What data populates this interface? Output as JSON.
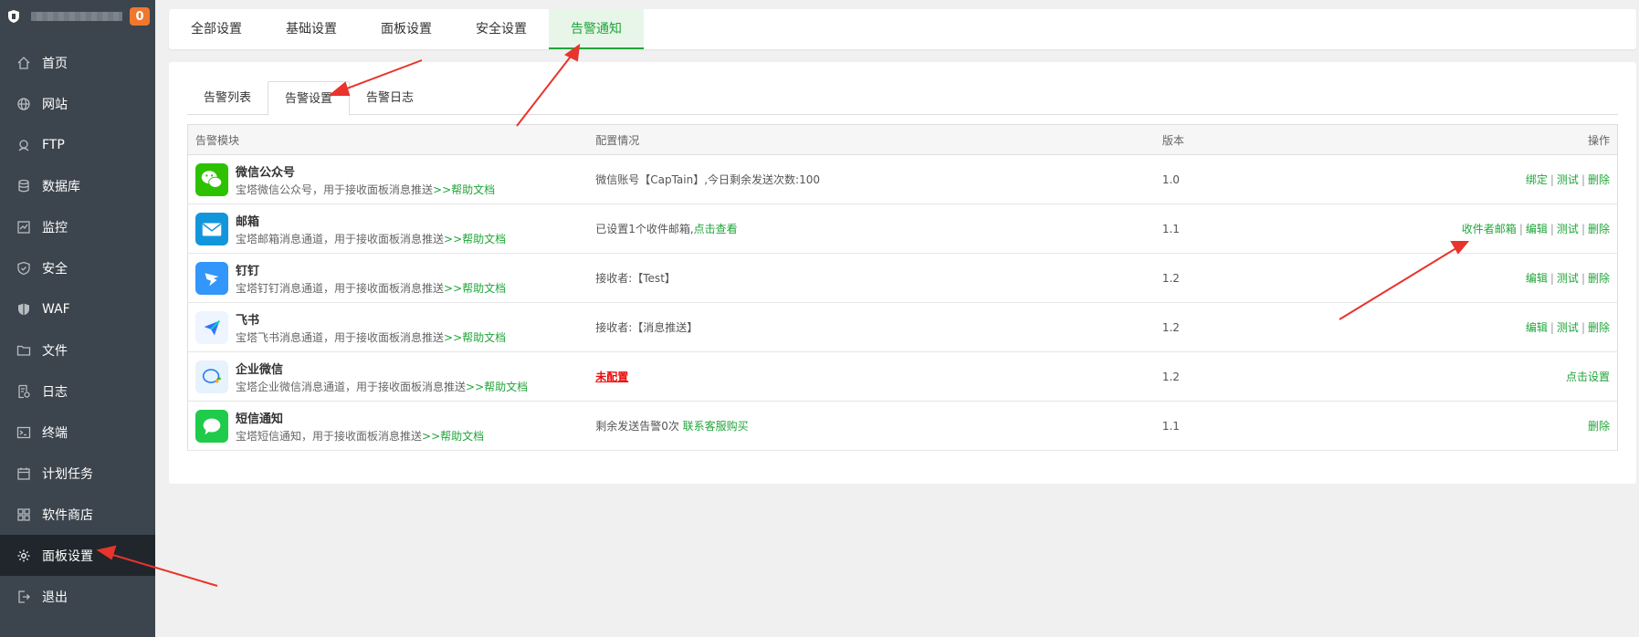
{
  "sidebar": {
    "badge": "0",
    "items": [
      {
        "label": "首页",
        "icon": "home-icon"
      },
      {
        "label": "网站",
        "icon": "globe-icon"
      },
      {
        "label": "FTP",
        "icon": "ftp-icon"
      },
      {
        "label": "数据库",
        "icon": "database-icon"
      },
      {
        "label": "监控",
        "icon": "monitor-icon"
      },
      {
        "label": "安全",
        "icon": "shield-icon"
      },
      {
        "label": "WAF",
        "icon": "waf-shield-icon"
      },
      {
        "label": "文件",
        "icon": "folder-icon"
      },
      {
        "label": "日志",
        "icon": "log-icon"
      },
      {
        "label": "终端",
        "icon": "terminal-icon"
      },
      {
        "label": "计划任务",
        "icon": "calendar-icon"
      },
      {
        "label": "软件商店",
        "icon": "grid-icon"
      },
      {
        "label": "面板设置",
        "icon": "gear-icon"
      },
      {
        "label": "退出",
        "icon": "logout-icon"
      }
    ]
  },
  "top_tabs": [
    "全部设置",
    "基础设置",
    "面板设置",
    "安全设置",
    "告警通知"
  ],
  "sub_tabs": [
    "告警列表",
    "告警设置",
    "告警日志"
  ],
  "table": {
    "headers": {
      "module": "告警模块",
      "config": "配置情况",
      "version": "版本",
      "action": "操作"
    },
    "rows": [
      {
        "name": "微信公众号",
        "desc": "宝塔微信公众号，用于接收面板消息推送",
        "help": ">>帮助文档",
        "config": "微信账号【CapTain】,今日剩余发送次数:100",
        "config_link": "",
        "version": "1.0",
        "actions": [
          "绑定",
          "测试",
          "删除"
        ]
      },
      {
        "name": "邮箱",
        "desc": "宝塔邮箱消息通道，用于接收面板消息推送",
        "help": ">>帮助文档",
        "config": "已设置1个收件邮箱,",
        "config_link": "点击查看",
        "version": "1.1",
        "actions": [
          "收件者邮箱",
          "编辑",
          "测试",
          "删除"
        ]
      },
      {
        "name": "钉钉",
        "desc": "宝塔钉钉消息通道，用于接收面板消息推送",
        "help": ">>帮助文档",
        "config": "接收者:【Test】",
        "config_link": "",
        "version": "1.2",
        "actions": [
          "编辑",
          "测试",
          "删除"
        ]
      },
      {
        "name": "飞书",
        "desc": "宝塔飞书消息通道，用于接收面板消息推送",
        "help": ">>帮助文档",
        "config": "接收者:【消息推送】",
        "config_link": "",
        "version": "1.2",
        "actions": [
          "编辑",
          "测试",
          "删除"
        ]
      },
      {
        "name": "企业微信",
        "desc": "宝塔企业微信消息通道，用于接收面板消息推送",
        "help": ">>帮助文档",
        "config": "",
        "config_unset": "未配置",
        "config_link": "",
        "version": "1.2",
        "actions": [
          "点击设置"
        ]
      },
      {
        "name": "短信通知",
        "desc": "宝塔短信通知，用于接收面板消息推送",
        "help": ">>帮助文档",
        "config": "剩余发送告警0次 ",
        "config_link": "联系客服购买",
        "version": "1.1",
        "actions": [
          "删除"
        ]
      }
    ]
  },
  "colors": {
    "accent": "#20a53a",
    "sidebar": "#3c444d",
    "badge": "#f0772e",
    "annotation": "#e8342c"
  }
}
